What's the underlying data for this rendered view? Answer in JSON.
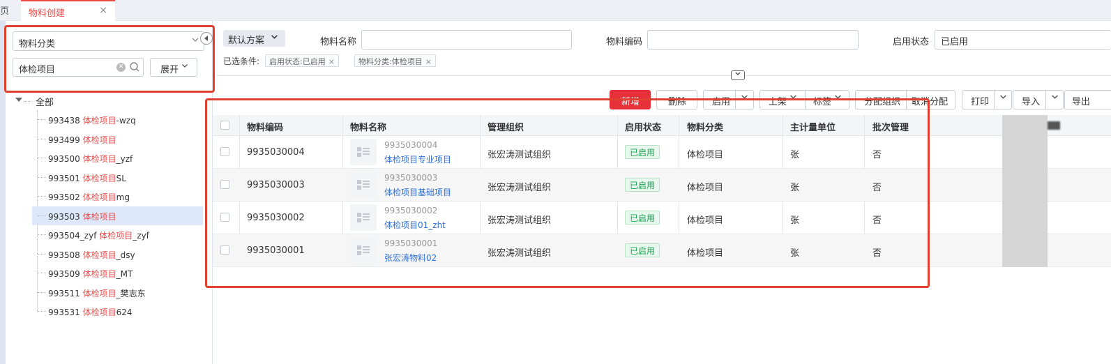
{
  "tabs": {
    "prev_label": "页",
    "active_label": "物料创建",
    "close_symbol": "×"
  },
  "sidebar": {
    "category_select": "物料分类",
    "search_value": "体检项目",
    "expand_label": "展开",
    "root_label": "全部",
    "items": [
      {
        "code": "993438 ",
        "hl": "体检项目",
        "suffix": "-wzq"
      },
      {
        "code": "993499 ",
        "hl": "体检项目",
        "suffix": ""
      },
      {
        "code": "993500 ",
        "hl": "体检项目",
        "suffix": "_yzf"
      },
      {
        "code": "993501 ",
        "hl": "体检项目",
        "suffix": "SL"
      },
      {
        "code": "993502 ",
        "hl": "体检项目",
        "suffix": "mg"
      },
      {
        "code": "993503 ",
        "hl": "体检项目",
        "suffix": ""
      },
      {
        "code": "993504_zyf ",
        "hl": "体检项目",
        "suffix": "_zyf"
      },
      {
        "code": "993508 ",
        "hl": "体检项目",
        "suffix": "_dsy"
      },
      {
        "code": "993509 ",
        "hl": "体检项目",
        "suffix": "_MT"
      },
      {
        "code": "993511 ",
        "hl": "体检项目",
        "suffix": "_樊志东"
      },
      {
        "code": "993531 ",
        "hl": "体检项目",
        "suffix": "624"
      }
    ],
    "selected_index": 5
  },
  "filters": {
    "scheme_label": "默认方案",
    "name_label": "物料名称",
    "name_value": "",
    "code_label": "物料编码",
    "code_value": "",
    "status_label": "启用状态",
    "status_value": "已启用",
    "selected_label": "已选条件:",
    "chips": [
      "启用状态:已启用",
      "物料分类:体检项目"
    ],
    "chip_close": "×"
  },
  "toolbar": {
    "new_label": "新增",
    "delete_label": "删除",
    "enable_label": "启用",
    "shelf_label": "上架",
    "tag_label": "标签",
    "assign_label": "分配组织",
    "unassign_label": "取消分配",
    "print_label": "打印",
    "import_label": "导入",
    "export_label": "导出"
  },
  "table": {
    "columns": [
      "物料编码",
      "物料名称",
      "管理组织",
      "启用状态",
      "物料分类",
      "主计量单位",
      "批次管理"
    ],
    "rows": [
      {
        "code": "9935030004",
        "sub_code": "9935030004",
        "name": "体检项目专业项目",
        "org": "张宏涛测试组织",
        "status": "已启用",
        "category": "体检项目",
        "unit": "张",
        "batch": "否"
      },
      {
        "code": "9935030003",
        "sub_code": "9935030003",
        "name": "体检项目基础项目",
        "org": "张宏涛测试组织",
        "status": "已启用",
        "category": "体检项目",
        "unit": "张",
        "batch": "否"
      },
      {
        "code": "9935030002",
        "sub_code": "9935030002",
        "name": "体检项目01_zht",
        "org": "张宏涛测试组织",
        "status": "已启用",
        "category": "体检项目",
        "unit": "张",
        "batch": "否"
      },
      {
        "code": "9935030001",
        "sub_code": "9935030001",
        "name": "张宏涛物料02",
        "org": "张宏涛测试组织",
        "status": "已启用",
        "category": "体检项目",
        "unit": "张",
        "batch": "否"
      }
    ]
  },
  "colors": {
    "accent": "#e94b4b",
    "primary_button": "#e8303a",
    "link": "#2f6fd6",
    "status_green": "#1aa253",
    "highlight_box": "#e0402e"
  }
}
